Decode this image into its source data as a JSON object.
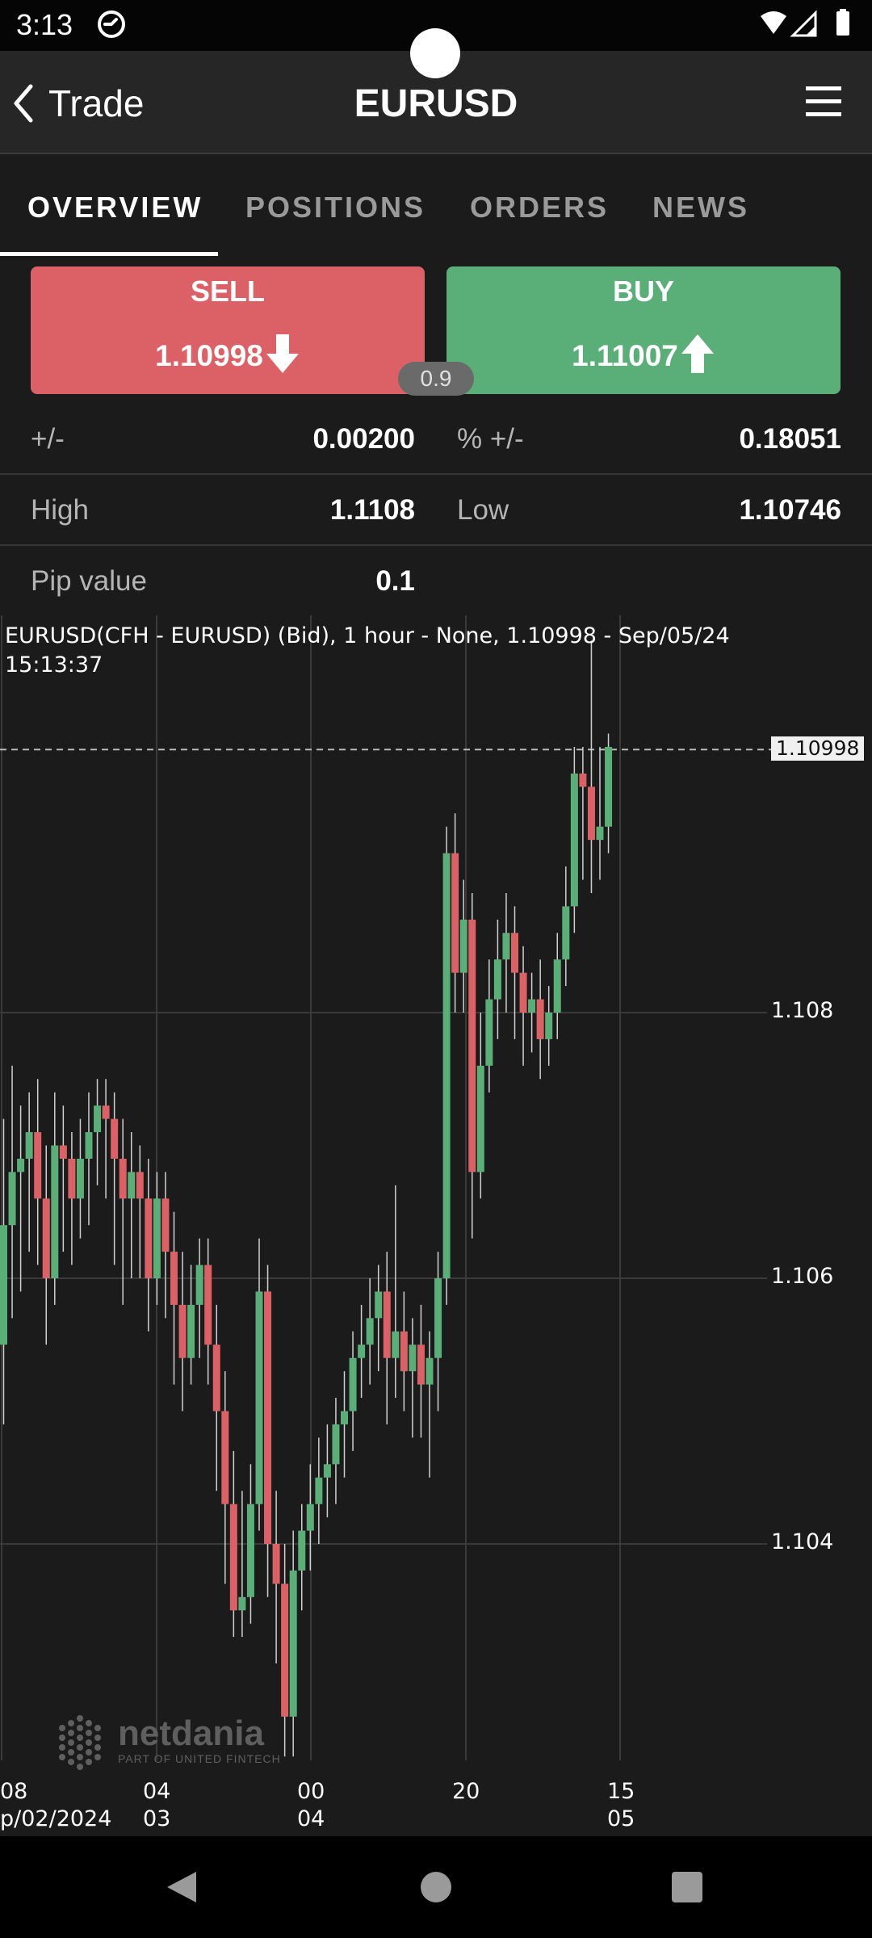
{
  "status_bar": {
    "time": "3:13",
    "icons": [
      "dnd-icon",
      "wifi-icon",
      "signal-icon",
      "battery-icon"
    ]
  },
  "header": {
    "back_label": "Trade",
    "title": "EURUSD",
    "menu_icon": "hamburger-menu-icon"
  },
  "tabs": [
    {
      "label": "OVERVIEW",
      "active": true
    },
    {
      "label": "POSITIONS",
      "active": false
    },
    {
      "label": "ORDERS",
      "active": false
    },
    {
      "label": "NEWS",
      "active": false
    }
  ],
  "trade": {
    "sell": {
      "label": "SELL",
      "price": "1.10998",
      "color": "#dc6166"
    },
    "buy": {
      "label": "BUY",
      "price": "1.11007",
      "color": "#5aae78"
    },
    "spread": "0.9"
  },
  "stats": {
    "change_label": "+/-",
    "change_value": "0.00200",
    "pct_label": "% +/-",
    "pct_value": "0.18051",
    "high_label": "High",
    "high_value": "1.1108",
    "low_label": "Low",
    "low_value": "1.10746",
    "pip_label": "Pip value",
    "pip_value": "0.1"
  },
  "chart": {
    "caption": "EURUSD(CFH - EURUSD) (Bid),  1 hour - None, 1.10998 - Sep/05/24 15:13:37",
    "last_price": "1.10998",
    "y_labels": [
      "1.108",
      "1.106",
      "1.104"
    ],
    "x_labels": [
      {
        "line1": "08",
        "line2": "p/02/2024"
      },
      {
        "line1": "04",
        "line2": "03"
      },
      {
        "line1": "00",
        "line2": "04"
      },
      {
        "line1": "20",
        "line2": ""
      },
      {
        "line1": "15",
        "line2": "05"
      }
    ],
    "watermark": "netdania",
    "watermark_sub": "PART OF UNITED FINTECH"
  },
  "chart_data": {
    "type": "candlestick",
    "title": "EURUSD(CFH - EURUSD) (Bid),  1 hour - None, 1.10998 - Sep/05/24 15:13:37",
    "ylim": [
      1.1023,
      1.1108
    ],
    "y_ticks": [
      1.104,
      1.106,
      1.108
    ],
    "last_price": 1.10998,
    "up_color": "#5aae78",
    "down_color": "#dc6166",
    "candles": [
      [
        1.1055,
        1.1064,
        1.1049,
        1.1072
      ],
      [
        1.1064,
        1.1068,
        1.1057,
        1.1076
      ],
      [
        1.1068,
        1.1069,
        1.1059,
        1.1073
      ],
      [
        1.1069,
        1.1071,
        1.1062,
        1.1074
      ],
      [
        1.1071,
        1.1066,
        1.1061,
        1.1075
      ],
      [
        1.1066,
        1.106,
        1.1055,
        1.107
      ],
      [
        1.106,
        1.107,
        1.1058,
        1.1074
      ],
      [
        1.107,
        1.1069,
        1.1062,
        1.1073
      ],
      [
        1.1069,
        1.1066,
        1.1061,
        1.1071
      ],
      [
        1.1066,
        1.1069,
        1.1063,
        1.1072
      ],
      [
        1.1069,
        1.1071,
        1.1064,
        1.1074
      ],
      [
        1.1071,
        1.1073,
        1.1067,
        1.1075
      ],
      [
        1.1073,
        1.1072,
        1.1066,
        1.1075
      ],
      [
        1.1072,
        1.1069,
        1.1061,
        1.1074
      ],
      [
        1.1069,
        1.1066,
        1.1058,
        1.1072
      ],
      [
        1.1066,
        1.1068,
        1.106,
        1.1071
      ],
      [
        1.1068,
        1.1066,
        1.106,
        1.107
      ],
      [
        1.1066,
        1.106,
        1.1056,
        1.1069
      ],
      [
        1.106,
        1.1066,
        1.1058,
        1.1068
      ],
      [
        1.1066,
        1.1062,
        1.1057,
        1.1068
      ],
      [
        1.1062,
        1.1058,
        1.1052,
        1.1065
      ],
      [
        1.1058,
        1.1054,
        1.105,
        1.1062
      ],
      [
        1.1054,
        1.1058,
        1.1052,
        1.1061
      ],
      [
        1.1058,
        1.1061,
        1.1054,
        1.1063
      ],
      [
        1.1061,
        1.1055,
        1.1052,
        1.1063
      ],
      [
        1.1055,
        1.105,
        1.1044,
        1.1058
      ],
      [
        1.105,
        1.1043,
        1.1037,
        1.1053
      ],
      [
        1.1043,
        1.1035,
        1.1033,
        1.1047
      ],
      [
        1.1035,
        1.1036,
        1.1033,
        1.1044
      ],
      [
        1.1036,
        1.1043,
        1.1034,
        1.1046
      ],
      [
        1.1043,
        1.1059,
        1.1041,
        1.1063
      ],
      [
        1.1059,
        1.104,
        1.1036,
        1.1061
      ],
      [
        1.104,
        1.1037,
        1.1031,
        1.1044
      ],
      [
        1.1037,
        1.1027,
        1.1024,
        1.104
      ],
      [
        1.1027,
        1.1038,
        1.1024,
        1.1041
      ],
      [
        1.1038,
        1.1041,
        1.1035,
        1.1043
      ],
      [
        1.1041,
        1.1043,
        1.1038,
        1.1046
      ],
      [
        1.1043,
        1.1045,
        1.104,
        1.1048
      ],
      [
        1.1045,
        1.1046,
        1.1042,
        1.1049
      ],
      [
        1.1046,
        1.1049,
        1.1043,
        1.1051
      ],
      [
        1.1049,
        1.105,
        1.1045,
        1.1053
      ],
      [
        1.105,
        1.1054,
        1.1047,
        1.1056
      ],
      [
        1.1054,
        1.1055,
        1.1051,
        1.1058
      ],
      [
        1.1055,
        1.1057,
        1.1052,
        1.106
      ],
      [
        1.1057,
        1.1059,
        1.1053,
        1.1061
      ],
      [
        1.1059,
        1.1054,
        1.1049,
        1.1062
      ],
      [
        1.1054,
        1.1056,
        1.1051,
        1.1067
      ],
      [
        1.1056,
        1.1053,
        1.105,
        1.1059
      ],
      [
        1.1053,
        1.1055,
        1.1048,
        1.1057
      ],
      [
        1.1055,
        1.1052,
        1.1048,
        1.1058
      ],
      [
        1.1052,
        1.1054,
        1.1045,
        1.1056
      ],
      [
        1.1054,
        1.106,
        1.105,
        1.1062
      ],
      [
        1.106,
        1.1092,
        1.1058,
        1.1094
      ],
      [
        1.1092,
        1.1083,
        1.108,
        1.1095
      ],
      [
        1.1083,
        1.1087,
        1.108,
        1.109
      ],
      [
        1.1087,
        1.1068,
        1.1063,
        1.1089
      ],
      [
        1.1068,
        1.1076,
        1.1066,
        1.108
      ],
      [
        1.1076,
        1.1081,
        1.1074,
        1.1084
      ],
      [
        1.1081,
        1.1084,
        1.1078,
        1.1087
      ],
      [
        1.1084,
        1.1086,
        1.108,
        1.1089
      ],
      [
        1.1086,
        1.1083,
        1.1078,
        1.1088
      ],
      [
        1.1083,
        1.108,
        1.1076,
        1.1085
      ],
      [
        1.108,
        1.1081,
        1.1077,
        1.1083
      ],
      [
        1.1081,
        1.1078,
        1.1075,
        1.1084
      ],
      [
        1.1078,
        1.108,
        1.1076,
        1.1082
      ],
      [
        1.108,
        1.1084,
        1.1078,
        1.1086
      ],
      [
        1.1084,
        1.1088,
        1.1082,
        1.1091
      ],
      [
        1.1088,
        1.1098,
        1.1086,
        1.11
      ],
      [
        1.1098,
        1.1097,
        1.109,
        1.11
      ],
      [
        1.1097,
        1.1093,
        1.1089,
        1.1108
      ],
      [
        1.1093,
        1.1094,
        1.109,
        1.11
      ],
      [
        1.1094,
        1.11,
        1.1092,
        1.1101
      ]
    ]
  }
}
